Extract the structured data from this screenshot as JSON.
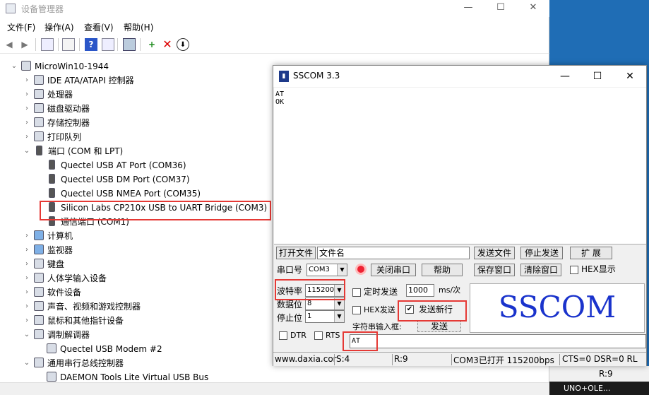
{
  "device_manager": {
    "title": "设备管理器",
    "caption": {
      "minimize": "—",
      "maximize": "☐",
      "close": "✕"
    },
    "menu": [
      "文件(F)",
      "操作(A)",
      "查看(V)",
      "帮助(H)"
    ],
    "toolbar_icons": [
      "back-arrow-icon",
      "forward-arrow-icon",
      "properties-icon",
      "update-icon",
      "help-icon",
      "view-icon",
      "monitor-icon",
      "add-driver-icon",
      "remove-device-icon",
      "scan-hardware-icon"
    ],
    "tree": {
      "root": "MicroWin10-1944",
      "items": [
        {
          "label": "IDE ATA/ATAPI 控制器",
          "expanded": false
        },
        {
          "label": "处理器",
          "expanded": false
        },
        {
          "label": "磁盘驱动器",
          "expanded": false
        },
        {
          "label": "存储控制器",
          "expanded": false
        },
        {
          "label": "打印队列",
          "expanded": false
        },
        {
          "label": "端口 (COM 和 LPT)",
          "expanded": true
        },
        {
          "label": "Quectel USB AT Port (COM36)",
          "child": true
        },
        {
          "label": "Quectel USB DM Port (COM37)",
          "child": true
        },
        {
          "label": "Quectel USB NMEA Port (COM35)",
          "child": true
        },
        {
          "label": "Silicon Labs CP210x USB to UART Bridge (COM3)",
          "child": true
        },
        {
          "label": "通信端口 (COM1)",
          "child": true
        },
        {
          "label": "计算机",
          "expanded": false
        },
        {
          "label": "监视器",
          "expanded": false
        },
        {
          "label": "键盘",
          "expanded": false
        },
        {
          "label": "人体学输入设备",
          "expanded": false
        },
        {
          "label": "软件设备",
          "expanded": false
        },
        {
          "label": "声音、视频和游戏控制器",
          "expanded": false
        },
        {
          "label": "鼠标和其他指针设备",
          "expanded": false
        },
        {
          "label": "调制解调器",
          "expanded": true
        },
        {
          "label": "Quectel USB Modem #2",
          "child": true
        },
        {
          "label": "通用串行总线控制器",
          "expanded": true
        },
        {
          "label": "DAEMON Tools Lite Virtual USB Bus",
          "child": true
        }
      ]
    }
  },
  "sscom": {
    "title": "SSCOM 3.3",
    "caption": {
      "minimize": "—",
      "maximize": "☐",
      "close": "✕"
    },
    "receive_lines": [
      "AT",
      "OK"
    ],
    "open_file_label": "打开文件",
    "filename_value": "文件名",
    "send_file_label": "发送文件",
    "stop_send_label": "停止发送",
    "expand_label": "扩 展",
    "port_label": "串口号",
    "port_value": "COM3",
    "close_port_label": "关闭串口",
    "help_label": "帮助",
    "save_window_label": "保存窗口",
    "clear_window_label": "清除窗口",
    "hex_display_label": "HEX显示",
    "baud_label": "波特率",
    "baud_value": "115200",
    "databits_label": "数据位",
    "databits_value": "8",
    "stopbits_label": "停止位",
    "stopbits_value": "1",
    "timed_send_label": "定时发送",
    "interval_value": "1000",
    "interval_unit": "ms/次",
    "hex_send_label": "HEX发送",
    "send_newline_label": "发送新行",
    "send_newline_checked": "✔",
    "dtr_label": "DTR",
    "rts_label": "RTS",
    "input_box_label": "字符串输入框:",
    "send_label": "发送",
    "input_value": "AT",
    "logo_text": "SSCOM",
    "status": {
      "site": "www.daxia.cor",
      "sent": "S:4",
      "received": "R:9",
      "port_state": "COM3已打开  115200bps",
      "signals": "CTS=0 DSR=0 RL"
    }
  },
  "background": {
    "behind_status": "R:9",
    "taskbar_text": "UNO+OLE..."
  }
}
